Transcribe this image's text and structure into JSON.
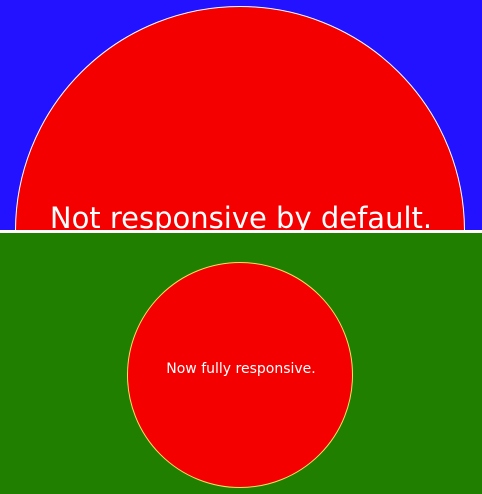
{
  "top_panel": {
    "label": "Not responsive by default.",
    "background_color": "#2312ff",
    "circle_color": "#f50000",
    "circle_border_color": "#ffffff"
  },
  "bottom_panel": {
    "label": "Now fully responsive.",
    "background_color": "#217f00",
    "circle_color": "#f50000",
    "circle_border_color": "#f0e060"
  },
  "divider_color": "#ffffff"
}
